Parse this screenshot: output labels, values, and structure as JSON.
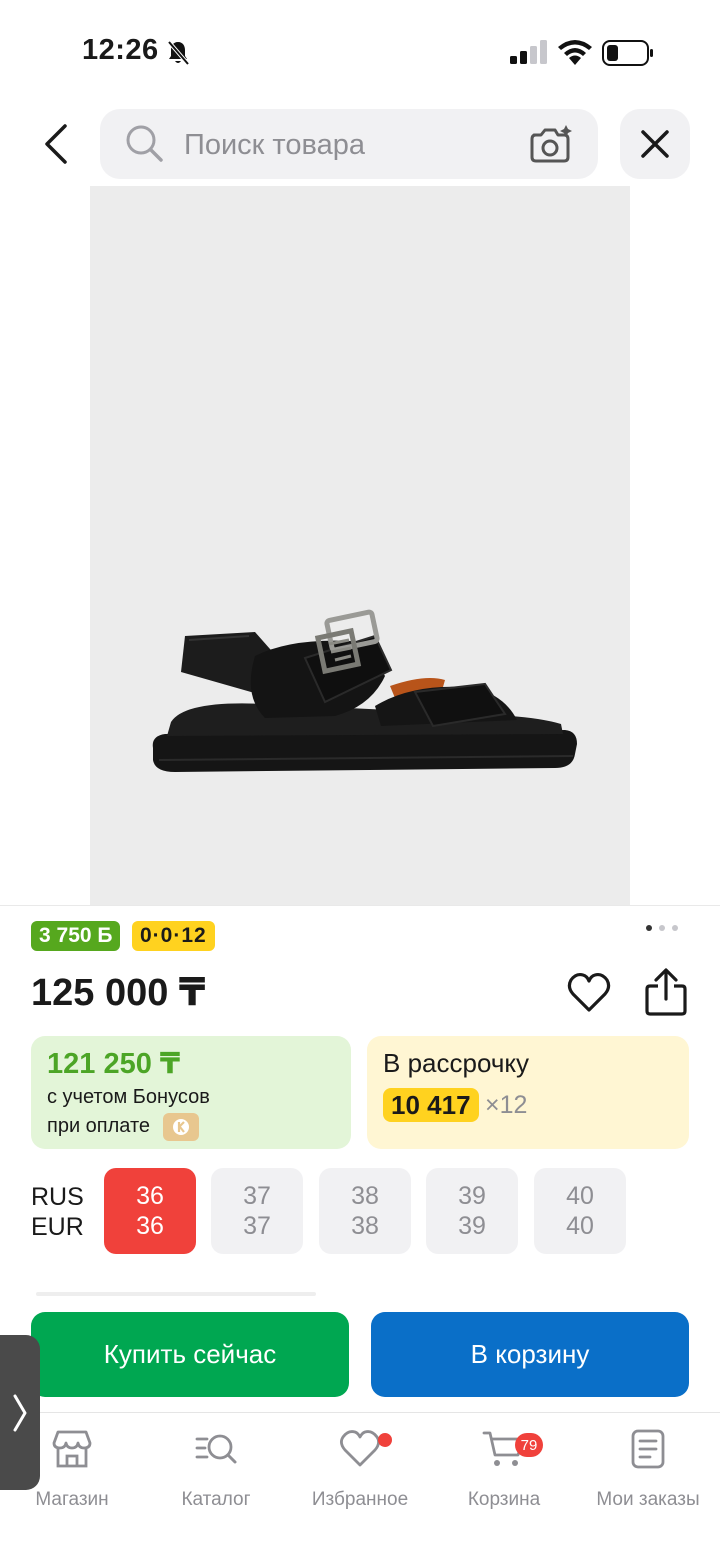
{
  "status_bar": {
    "time": "12:26"
  },
  "search": {
    "placeholder": "Поиск товара"
  },
  "badges": {
    "bonus": "3 750 Б",
    "installment": "0·0·12"
  },
  "price": "125 000 ₸",
  "bonus_card": {
    "price": "121 250 ₸",
    "line1": "с учетом Бонусов",
    "line2": "при оплате"
  },
  "installment_card": {
    "title": "В рассрочку",
    "amount": "10 417",
    "months": "×12"
  },
  "sizes": {
    "label_rus": "RUS",
    "label_eur": "EUR",
    "items": [
      {
        "rus": "36",
        "eur": "36",
        "selected": true
      },
      {
        "rus": "37",
        "eur": "37",
        "selected": false
      },
      {
        "rus": "38",
        "eur": "38",
        "selected": false
      },
      {
        "rus": "39",
        "eur": "39",
        "selected": false
      },
      {
        "rus": "40",
        "eur": "40",
        "selected": false
      }
    ]
  },
  "actions": {
    "buy": "Купить сейчас",
    "cart": "В корзину"
  },
  "gallery": {
    "total": 3,
    "active_index": 0
  },
  "nav": {
    "items": [
      {
        "label": "Магазин",
        "icon": "shop-icon"
      },
      {
        "label": "Каталог",
        "icon": "catalog-search-icon"
      },
      {
        "label": "Избранное",
        "icon": "heart-icon"
      },
      {
        "label": "Корзина",
        "icon": "cart-icon"
      },
      {
        "label": "Мои заказы",
        "icon": "orders-icon"
      }
    ],
    "cart_count": "79"
  },
  "colors": {
    "green_price": "#4ca526",
    "selected_size": "#f0413b",
    "buy": "#00a751",
    "cart": "#0a6fc8",
    "yellow": "#ffd21f"
  }
}
